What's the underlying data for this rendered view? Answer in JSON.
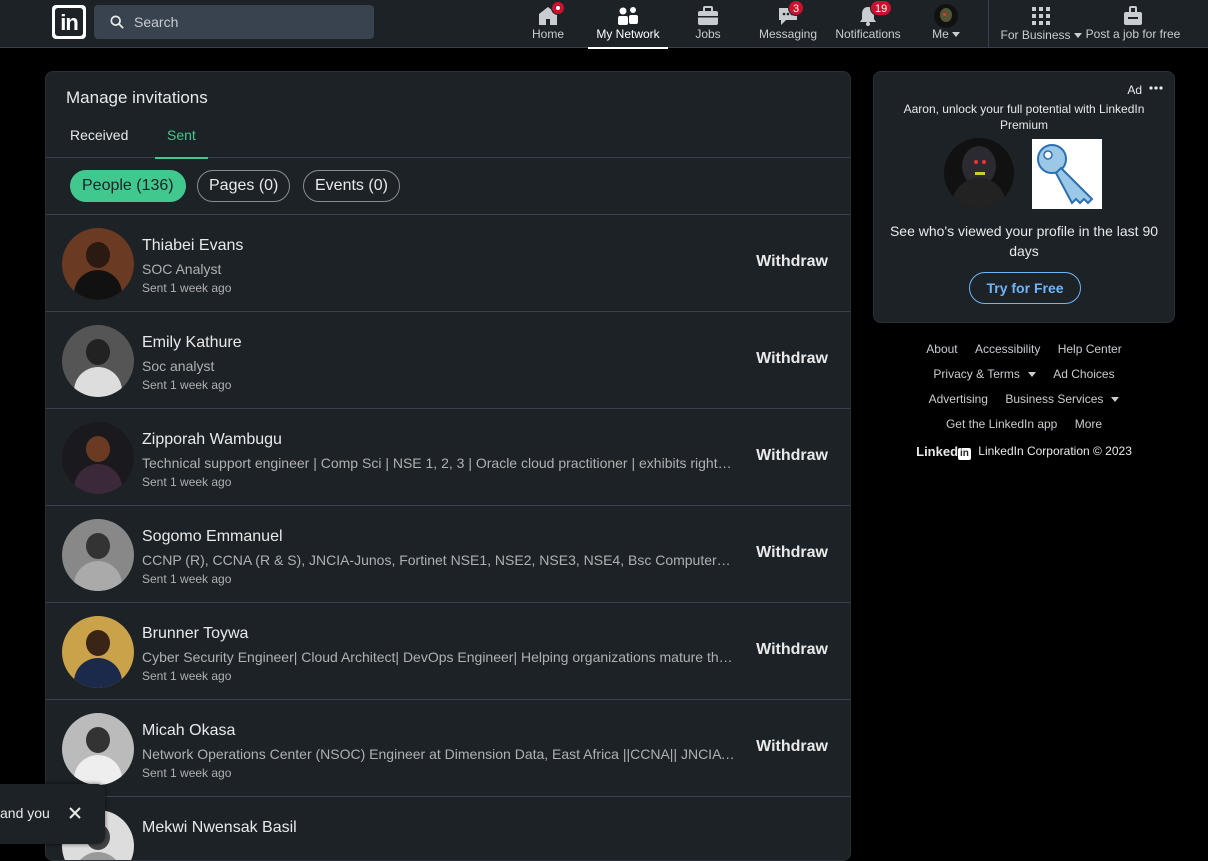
{
  "nav": {
    "search_placeholder": "Search",
    "items": [
      {
        "label": "Home",
        "icon": "home-icon"
      },
      {
        "label": "My Network",
        "icon": "network-icon"
      },
      {
        "label": "Jobs",
        "icon": "briefcase-icon"
      },
      {
        "label": "Messaging",
        "icon": "chat-icon",
        "badge": "3"
      },
      {
        "label": "Notifications",
        "icon": "bell-icon",
        "badge": "19"
      },
      {
        "label": "Me",
        "icon": "avatar"
      }
    ],
    "business_label": "For Business",
    "post_job_label": "Post a job for free",
    "active": "My Network"
  },
  "main": {
    "title": "Manage invitations",
    "tabs": [
      {
        "label": "Received"
      },
      {
        "label": "Sent"
      }
    ],
    "active_tab": "Sent",
    "filters": [
      {
        "label": "People (136)"
      },
      {
        "label": "Pages (0)"
      },
      {
        "label": "Events (0)"
      }
    ],
    "withdraw_label": "Withdraw",
    "invitations": [
      {
        "name": "Thiabei Evans",
        "headline": "SOC Analyst",
        "time": "Sent 1 week ago"
      },
      {
        "name": "Emily Kathure",
        "headline": "Soc analyst",
        "time": "Sent 1 week ago"
      },
      {
        "name": "Zipporah Wambugu",
        "headline": "Technical support engineer | Comp Sci | NSE 1, 2, 3 | Oracle cloud practitioner | exhibits right…",
        "time": "Sent 1 week ago"
      },
      {
        "name": "Sogomo Emmanuel",
        "headline": "CCNP (R), CCNA (R & S), JNCIA-Junos, Fortinet NSE1, NSE2, NSE3, NSE4, Bsc Computer…",
        "time": "Sent 1 week ago"
      },
      {
        "name": "Brunner Toywa",
        "headline": "Cyber Security Engineer| Cloud Architect| DevOps Engineer| Helping organizations mature their…",
        "time": "Sent 1 week ago"
      },
      {
        "name": "Micah Okasa",
        "headline": "Network Operations Center (NSOC) Engineer at Dimension Data, East Africa ||CCNA|| JNCIA ||…",
        "time": "Sent 1 week ago"
      },
      {
        "name": "Mekwi Nwensak Basil",
        "headline": "",
        "time": ""
      }
    ]
  },
  "ad": {
    "label": "Ad",
    "message": "Aaron, unlock your full potential with LinkedIn Premium",
    "headline": "See who's viewed your profile in the last 90 days",
    "cta": "Try for Free"
  },
  "footer": {
    "links_row1": [
      "About",
      "Accessibility",
      "Help Center"
    ],
    "links_row2": [
      "Privacy & Terms",
      "Ad Choices"
    ],
    "links_row3": [
      "Advertising",
      "Business Services"
    ],
    "links_row4": [
      "Get the LinkedIn app",
      "More"
    ],
    "brand": "Linked",
    "brand_in": "in",
    "copyright": "LinkedIn Corporation © 2023"
  },
  "toast": {
    "text": "and you"
  },
  "colors": {
    "accent_green": "#41c88f",
    "link_blue": "#70b5f9",
    "badge_red": "#cb112d",
    "card_bg": "#1d2226"
  }
}
